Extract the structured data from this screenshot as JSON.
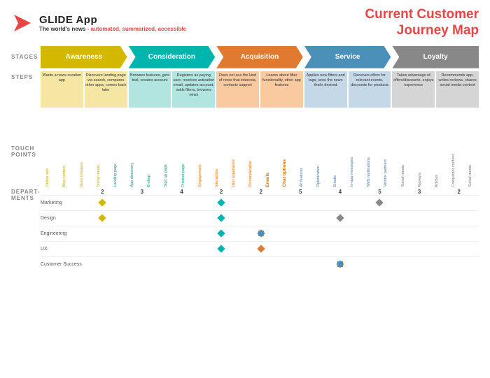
{
  "logo": {
    "title": "GLIDE App",
    "tagline_prefix": "The world's news",
    "tagline_suffix": "- automated, summarized, accessible"
  },
  "page_title_line1": "Current Customer",
  "page_title_line2": "Journey Map",
  "stages": {
    "label": "STAGES",
    "items": [
      {
        "name": "Awareness",
        "color": "#d4b800"
      },
      {
        "name": "Consideration",
        "color": "#00b5ad"
      },
      {
        "name": "Acquisition",
        "color": "#e07a30"
      },
      {
        "name": "Service",
        "color": "#4a90b8"
      },
      {
        "name": "Loyalty",
        "color": "#888888"
      }
    ]
  },
  "steps": {
    "label": "STEPS",
    "items": [
      {
        "text": "Wants a news curation app",
        "bg": "yellow"
      },
      {
        "text": "Discovers landing page via search, compares other apps, comes back later",
        "bg": "yellow"
      },
      {
        "text": "Browses features, gets trial, creates account",
        "bg": "teal"
      },
      {
        "text": "Registers as paying user, receives activation email, updates account, adds filters, browses news",
        "bg": "teal"
      },
      {
        "text": "Does not see the kind of news that interests, contacts support",
        "bg": "orange"
      },
      {
        "text": "Learns about filter functionality, other app features",
        "bg": "orange"
      },
      {
        "text": "Applies new filters and tags, sees the news that's desired",
        "bg": "blue-gray"
      },
      {
        "text": "Receives offers for relevant events, discounts for products",
        "bg": "blue-gray"
      },
      {
        "text": "Takes advantage of offers/ discounts, enjoys experience",
        "bg": "gray"
      },
      {
        "text": "Recommends app, writes reviews, shares social media content",
        "bg": "gray"
      }
    ]
  },
  "touchpoints": {
    "label": "TOUCH POINTS",
    "items": [
      {
        "name": "Online ads",
        "color": "yellow"
      },
      {
        "name": "Blog content",
        "color": "yellow"
      },
      {
        "name": "News releases",
        "color": "yellow"
      },
      {
        "name": "Social media",
        "color": "yellow"
      },
      {
        "name": "Landing page",
        "color": "teal"
      },
      {
        "name": "App discovery",
        "color": "teal"
      },
      {
        "name": "E-shop",
        "color": "teal"
      },
      {
        "name": "Sign up page",
        "color": "teal"
      },
      {
        "name": "Product page",
        "color": "teal"
      },
      {
        "name": "Engagement",
        "color": "orange"
      },
      {
        "name": "Interaction",
        "color": "orange"
      },
      {
        "name": "User experience",
        "color": "orange"
      },
      {
        "name": "Personalization",
        "color": "orange"
      },
      {
        "name": "Emails",
        "color": "orange",
        "bold": true
      },
      {
        "name": "Chat options",
        "color": "orange",
        "bold": true
      },
      {
        "name": "All features",
        "color": "blue-gray"
      },
      {
        "name": "Optimization",
        "color": "blue-gray"
      },
      {
        "name": "Emails",
        "color": "blue-gray"
      },
      {
        "name": "In-app messages",
        "color": "blue-gray"
      },
      {
        "name": "SMS notifications",
        "color": "blue-gray"
      },
      {
        "name": "Vendor partners",
        "color": "blue-gray"
      },
      {
        "name": "Social media",
        "color": "gray"
      },
      {
        "name": "Reviews",
        "color": "gray"
      },
      {
        "name": "Articles",
        "color": "gray"
      },
      {
        "name": "Competitor content",
        "color": "gray"
      },
      {
        "name": "Social media",
        "color": "gray"
      }
    ]
  },
  "departments": {
    "label": "DEPARTMENTS",
    "counts": [
      2,
      3,
      4,
      2,
      2,
      5,
      4,
      5,
      3,
      2
    ],
    "rows": [
      {
        "name": "Marketing",
        "diamonds": [
          {
            "col": 0,
            "color": "#d4b800"
          },
          {
            "col": 4,
            "color": "#00b5ad"
          },
          {
            "col": 9,
            "color": "#888"
          }
        ]
      },
      {
        "name": "Design",
        "diamonds": [
          {
            "col": 0,
            "color": "#d4b800"
          },
          {
            "col": 4,
            "color": "#00b5ad"
          },
          {
            "col": 8,
            "color": "#888"
          }
        ]
      },
      {
        "name": "Engineering",
        "diamonds": [
          {
            "col": 3,
            "color": "#00b5ad"
          },
          {
            "col": 5,
            "color": "#e07a30"
          },
          {
            "col": 6,
            "color": "#e07a30"
          },
          {
            "col": 7,
            "color": "#4a90b8"
          }
        ]
      },
      {
        "name": "UX",
        "diamonds": [
          {
            "col": 3,
            "color": "#00b5ad"
          },
          {
            "col": 5,
            "color": "#e07a30"
          }
        ]
      },
      {
        "name": "Customer Success",
        "diamonds": [
          {
            "col": 6,
            "color": "#e07a30"
          },
          {
            "col": 7,
            "color": "#4a90b8"
          }
        ]
      }
    ]
  }
}
